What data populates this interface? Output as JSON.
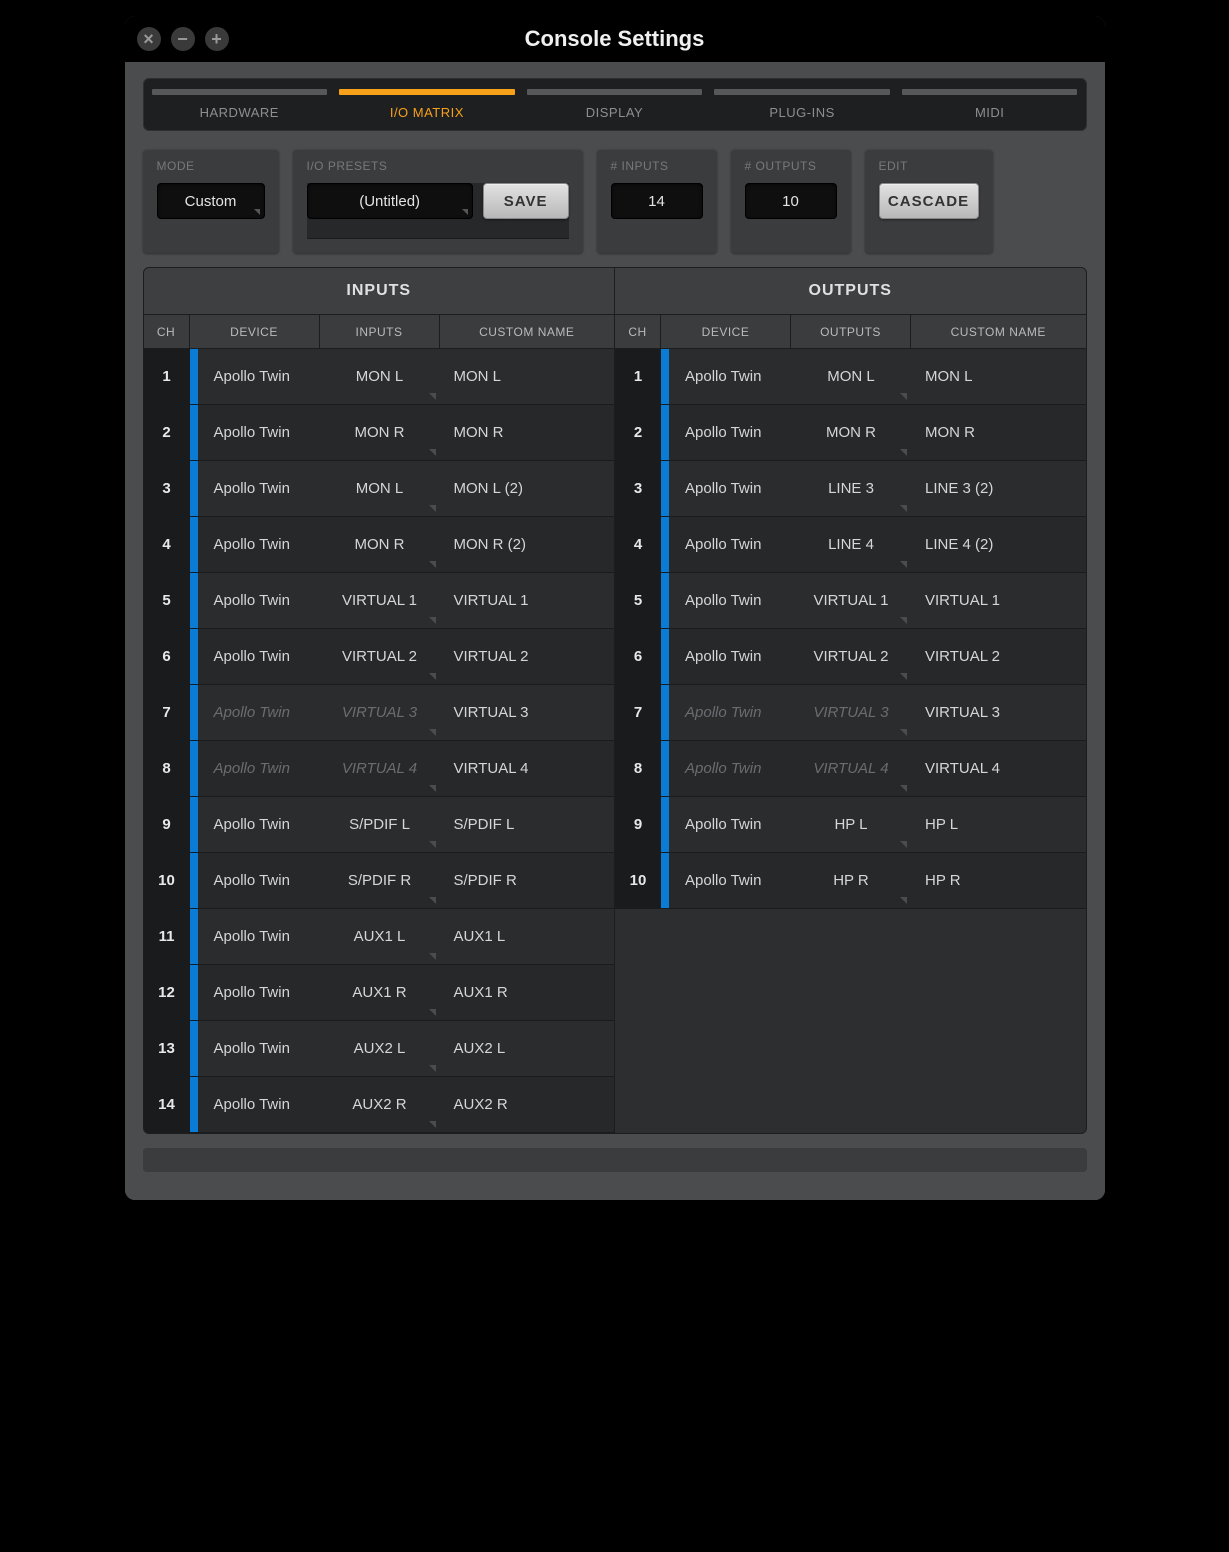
{
  "title": "Console Settings",
  "tabs": [
    {
      "label": "HARDWARE",
      "active": false
    },
    {
      "label": "I/O MATRIX",
      "active": true
    },
    {
      "label": "DISPLAY",
      "active": false
    },
    {
      "label": "PLUG-INS",
      "active": false
    },
    {
      "label": "MIDI",
      "active": false
    }
  ],
  "panels": {
    "mode": {
      "label": "MODE",
      "value": "Custom"
    },
    "presets": {
      "label": "I/O PRESETS",
      "value": "(Untitled)",
      "save": "SAVE"
    },
    "inputs": {
      "label": "# INPUTS",
      "value": "14"
    },
    "outputs": {
      "label": "# OUTPUTS",
      "value": "10"
    },
    "edit": {
      "label": "EDIT",
      "button": "CASCADE"
    }
  },
  "matrix": {
    "inputs_title": "INPUTS",
    "outputs_title": "OUTPUTS",
    "subhead": {
      "ch": "CH",
      "device": "DEVICE",
      "inputs": "INPUTS",
      "outputs": "OUTPUTS",
      "custom": "CUSTOM NAME"
    },
    "inputs": [
      {
        "ch": "1",
        "device": "Apollo Twin",
        "io": "MON L",
        "name": "MON L",
        "muted": false
      },
      {
        "ch": "2",
        "device": "Apollo Twin",
        "io": "MON R",
        "name": "MON R",
        "muted": false
      },
      {
        "ch": "3",
        "device": "Apollo Twin",
        "io": "MON L",
        "name": "MON L (2)",
        "muted": false
      },
      {
        "ch": "4",
        "device": "Apollo Twin",
        "io": "MON R",
        "name": "MON R (2)",
        "muted": false
      },
      {
        "ch": "5",
        "device": "Apollo Twin",
        "io": "VIRTUAL 1",
        "name": "VIRTUAL 1",
        "muted": false
      },
      {
        "ch": "6",
        "device": "Apollo Twin",
        "io": "VIRTUAL 2",
        "name": "VIRTUAL 2",
        "muted": false
      },
      {
        "ch": "7",
        "device": "Apollo Twin",
        "io": "VIRTUAL 3",
        "name": "VIRTUAL 3",
        "muted": true
      },
      {
        "ch": "8",
        "device": "Apollo Twin",
        "io": "VIRTUAL 4",
        "name": "VIRTUAL 4",
        "muted": true
      },
      {
        "ch": "9",
        "device": "Apollo Twin",
        "io": "S/PDIF L",
        "name": "S/PDIF L",
        "muted": false
      },
      {
        "ch": "10",
        "device": "Apollo Twin",
        "io": "S/PDIF R",
        "name": "S/PDIF R",
        "muted": false
      },
      {
        "ch": "11",
        "device": "Apollo Twin",
        "io": "AUX1 L",
        "name": "AUX1 L",
        "muted": false
      },
      {
        "ch": "12",
        "device": "Apollo Twin",
        "io": "AUX1 R",
        "name": "AUX1 R",
        "muted": false
      },
      {
        "ch": "13",
        "device": "Apollo Twin",
        "io": "AUX2 L",
        "name": "AUX2 L",
        "muted": false
      },
      {
        "ch": "14",
        "device": "Apollo Twin",
        "io": "AUX2 R",
        "name": "AUX2 R",
        "muted": false
      }
    ],
    "outputs": [
      {
        "ch": "1",
        "device": "Apollo Twin",
        "io": "MON L",
        "name": "MON L",
        "muted": false
      },
      {
        "ch": "2",
        "device": "Apollo Twin",
        "io": "MON R",
        "name": "MON R",
        "muted": false
      },
      {
        "ch": "3",
        "device": "Apollo Twin",
        "io": "LINE 3",
        "name": "LINE 3 (2)",
        "muted": false
      },
      {
        "ch": "4",
        "device": "Apollo Twin",
        "io": "LINE 4",
        "name": "LINE 4 (2)",
        "muted": false
      },
      {
        "ch": "5",
        "device": "Apollo Twin",
        "io": "VIRTUAL 1",
        "name": "VIRTUAL 1",
        "muted": false
      },
      {
        "ch": "6",
        "device": "Apollo Twin",
        "io": "VIRTUAL 2",
        "name": "VIRTUAL 2",
        "muted": false
      },
      {
        "ch": "7",
        "device": "Apollo Twin",
        "io": "VIRTUAL 3",
        "name": "VIRTUAL 3",
        "muted": true
      },
      {
        "ch": "8",
        "device": "Apollo Twin",
        "io": "VIRTUAL 4",
        "name": "VIRTUAL 4",
        "muted": true
      },
      {
        "ch": "9",
        "device": "Apollo Twin",
        "io": "HP L",
        "name": "HP L",
        "muted": false
      },
      {
        "ch": "10",
        "device": "Apollo Twin",
        "io": "HP R",
        "name": "HP R",
        "muted": false
      }
    ]
  }
}
